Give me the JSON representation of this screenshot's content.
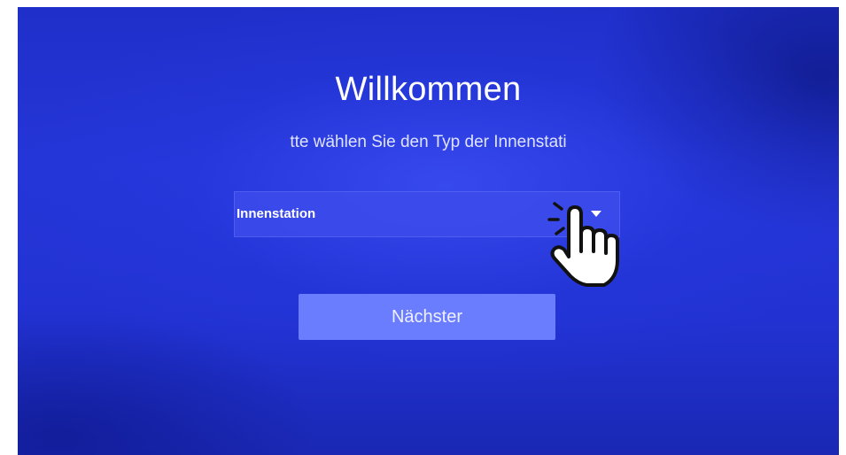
{
  "welcome": {
    "title": "Willkommen",
    "subtitle": "tte wählen Sie den Typ der Innenstati"
  },
  "station_select": {
    "selected_value": "Innenstation"
  },
  "actions": {
    "next_label": "Nächster"
  },
  "icons": {
    "dropdown": "chevron-down-icon",
    "pointer": "hand-pointer-icon"
  },
  "colors": {
    "background": "#2232d2",
    "button": "#6b7dff",
    "select": "#3c4beb",
    "text": "#ffffff"
  }
}
